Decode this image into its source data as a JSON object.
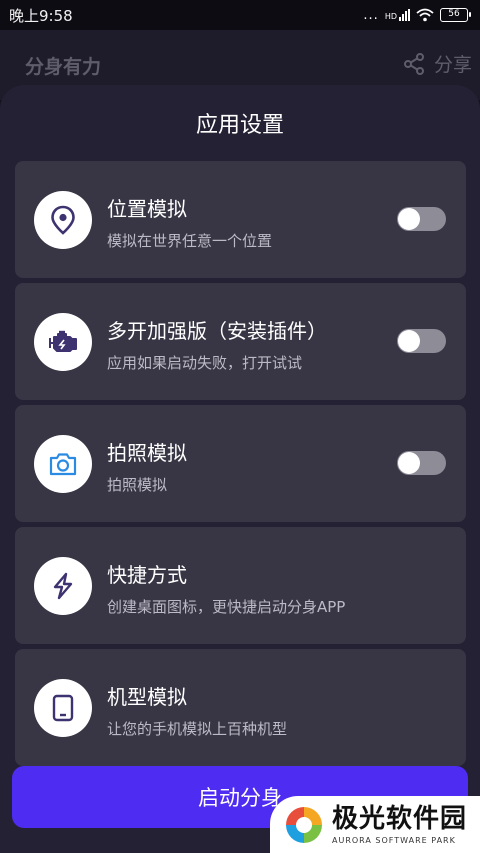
{
  "status_bar": {
    "time": "晚上9:58",
    "dots": "...",
    "network": "HD",
    "battery": "56"
  },
  "app_header": {
    "title": "分身有力",
    "share_label": "分享"
  },
  "sheet": {
    "title": "应用设置",
    "options": [
      {
        "title": "位置模拟",
        "desc": "模拟在世界任意一个位置",
        "icon": "location-pin-icon",
        "toggle": "off"
      },
      {
        "title": "多开加强版（安装插件）",
        "desc": "应用如果启动失败，打开试试",
        "icon": "engine-icon",
        "toggle": "off"
      },
      {
        "title": "拍照模拟",
        "desc": "拍照模拟",
        "icon": "camera-icon",
        "toggle": "off"
      },
      {
        "title": "快捷方式",
        "desc": "创建桌面图标，更快捷启动分身APP",
        "icon": "lightning-icon"
      },
      {
        "title": "机型模拟",
        "desc": "让您的手机模拟上百种机型",
        "icon": "phone-icon"
      }
    ],
    "start_button": "启动分身"
  },
  "watermark": {
    "main": "极光软件园",
    "sub": "AURORA SOFTWARE PARK"
  },
  "colors": {
    "accent": "#4f2cf1",
    "icon": "#3e3370",
    "card": "#383644",
    "sheet": "#242134"
  }
}
